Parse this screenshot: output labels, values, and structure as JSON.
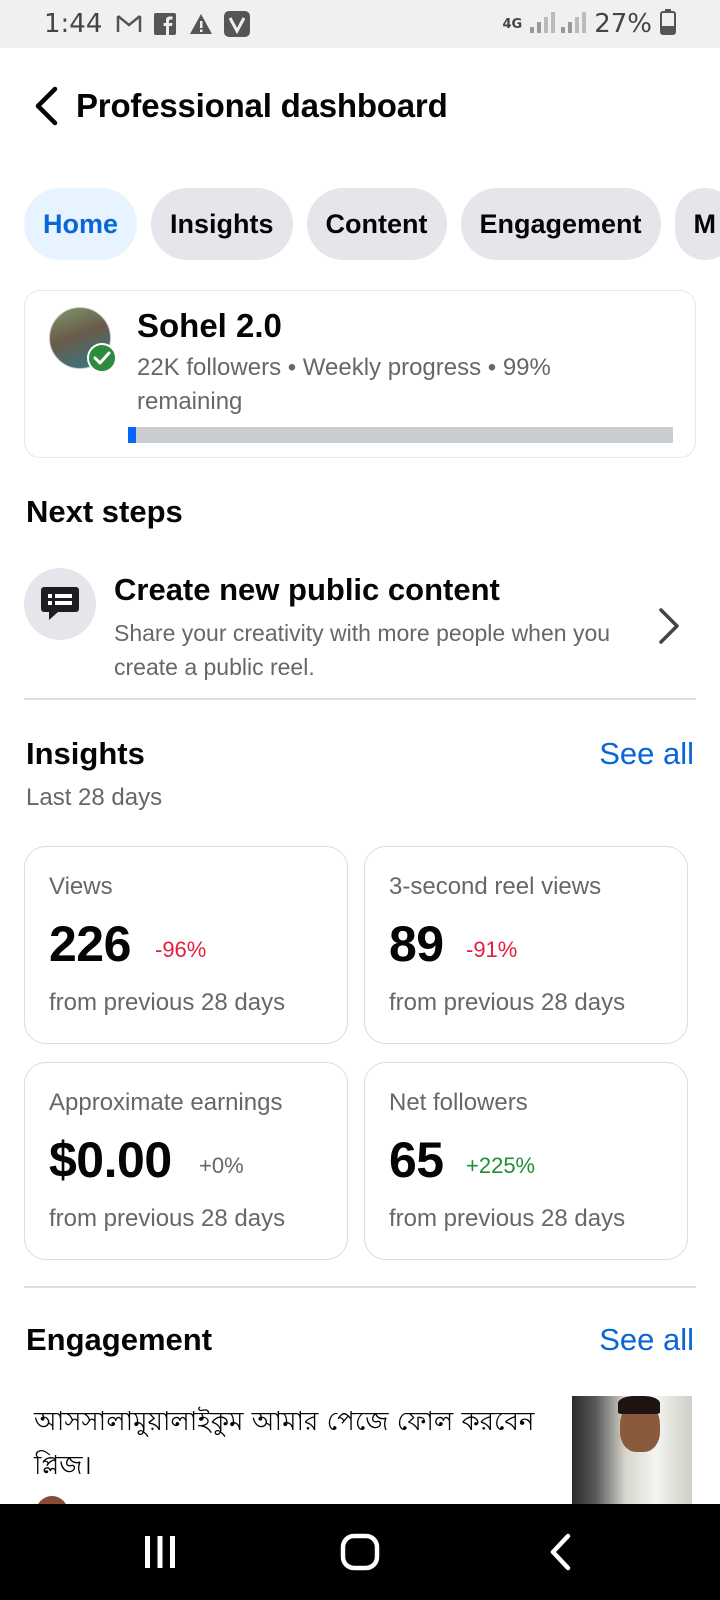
{
  "status_bar": {
    "time": "1:44",
    "network": "4G",
    "battery": "27%",
    "icons": [
      "gmail-icon",
      "facebook-icon",
      "alert-icon",
      "vivo-icon",
      "signal-icon",
      "battery-icon"
    ]
  },
  "header": {
    "title": "Professional dashboard"
  },
  "tabs": [
    {
      "label": "Home",
      "active": true
    },
    {
      "label": "Insights",
      "active": false
    },
    {
      "label": "Content",
      "active": false
    },
    {
      "label": "Engagement",
      "active": false
    },
    {
      "label": "M",
      "active": false
    }
  ],
  "profile": {
    "name": "Sohel 2.0",
    "meta": "22K followers • Weekly progress • 99% remaining",
    "progress_fraction": 0.01
  },
  "next_steps": {
    "title": "Next steps",
    "item": {
      "title": "Create new public content",
      "description": "Share your creativity with more people when you create a public reel."
    }
  },
  "insights": {
    "title": "Insights",
    "see_all": "See all",
    "subtitle": "Last 28 days",
    "cards": [
      {
        "label": "Views",
        "value": "226",
        "change": "-96%",
        "foot": "from previous 28 days"
      },
      {
        "label": "3-second reel views",
        "value": "89",
        "change": "-91%",
        "foot": "from previous 28 days"
      },
      {
        "label": "Approximate earnings",
        "value": "$0.00",
        "change": "+0%",
        "foot": "from previous 28 days"
      },
      {
        "label": "Net followers",
        "value": "65",
        "change": "+225%",
        "foot": "from previous 28 days"
      }
    ]
  },
  "engagement": {
    "title": "Engagement",
    "see_all": "See all",
    "post_text": "আসসালামুয়ালাইকুম আমার পেজে ফোল করবেন প্লিজ।"
  },
  "colors": {
    "accent": "#0866d6",
    "negative": "#e41e3f",
    "positive": "#1e8f3a",
    "progress": "#0866ff"
  }
}
